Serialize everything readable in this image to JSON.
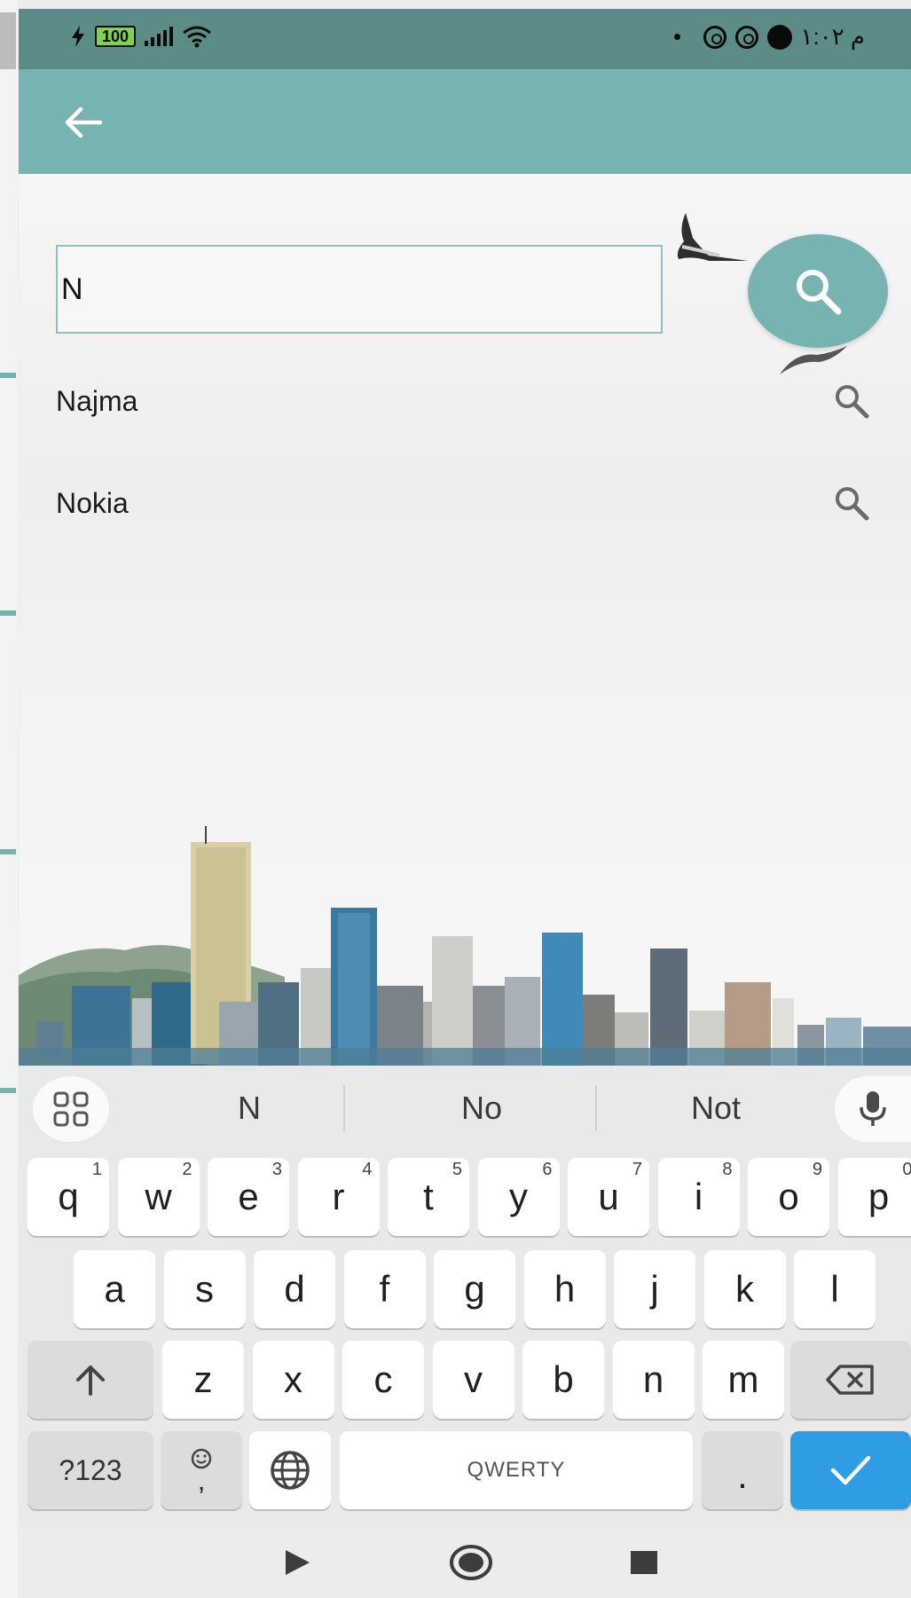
{
  "status_bar": {
    "battery": "100",
    "time": "م ١:٠٢"
  },
  "search": {
    "query": "N"
  },
  "suggestions": [
    {
      "label": "Najma",
      "icon": "search-icon"
    },
    {
      "label": "Nokia",
      "icon": "search-icon"
    }
  ],
  "keyboard": {
    "suggestions": [
      "N",
      "No",
      "Not"
    ],
    "row1": [
      {
        "k": "q",
        "h": "1"
      },
      {
        "k": "w",
        "h": "2"
      },
      {
        "k": "e",
        "h": "3"
      },
      {
        "k": "r",
        "h": "4"
      },
      {
        "k": "t",
        "h": "5"
      },
      {
        "k": "y",
        "h": "6"
      },
      {
        "k": "u",
        "h": "7"
      },
      {
        "k": "i",
        "h": "8"
      },
      {
        "k": "o",
        "h": "9"
      },
      {
        "k": "p",
        "h": "0"
      }
    ],
    "row2": [
      "a",
      "s",
      "d",
      "f",
      "g",
      "h",
      "j",
      "k",
      "l"
    ],
    "row3": [
      "z",
      "x",
      "c",
      "v",
      "b",
      "n",
      "m"
    ],
    "symbols_label": "?123",
    "comma_label": ",",
    "space_label": "QWERTY",
    "period_label": "."
  },
  "colors": {
    "status_bar": "#5b8c87",
    "app_bar": "#76b3b1",
    "enter_key": "#2f9de4"
  }
}
